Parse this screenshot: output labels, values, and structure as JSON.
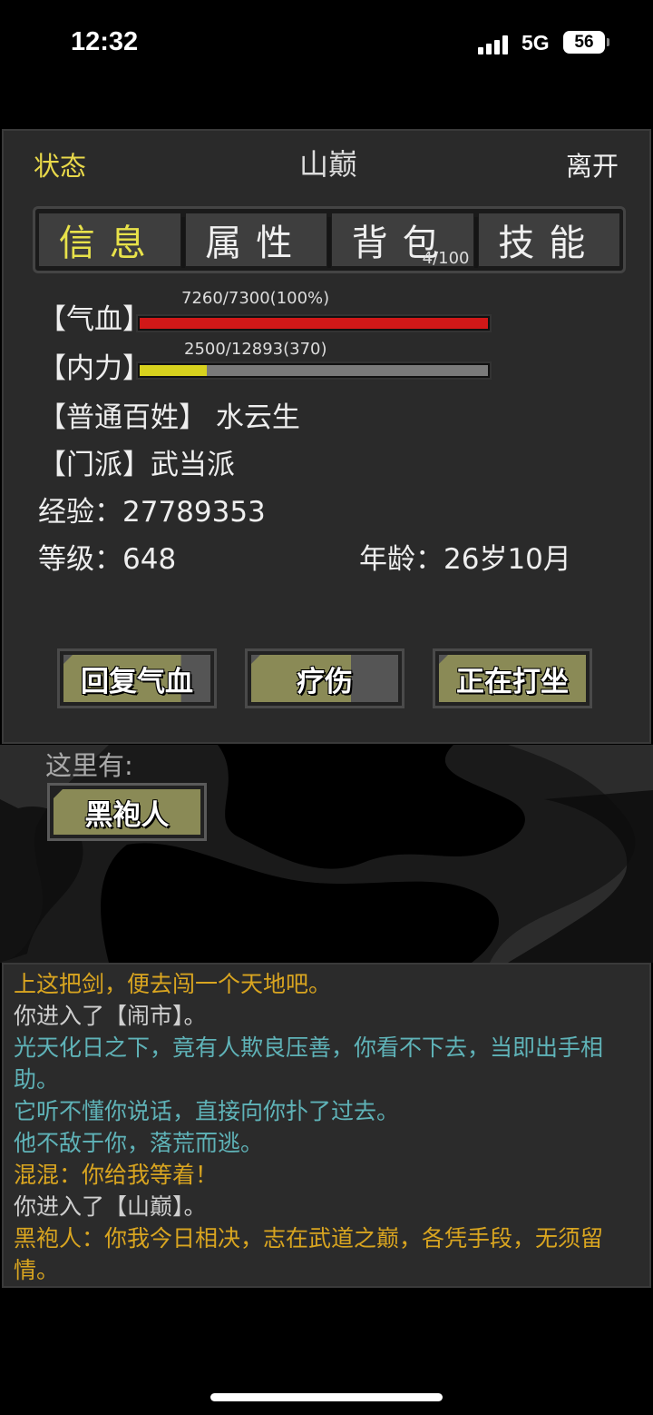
{
  "status_bar": {
    "time": "12:32",
    "network": "5G",
    "battery": "56"
  },
  "header": {
    "status_label": "状态",
    "title": "山巅",
    "leave_label": "离开"
  },
  "tabs": [
    {
      "label": "信息",
      "active": true
    },
    {
      "label": "属性",
      "active": false
    },
    {
      "label": "背包",
      "active": false,
      "badge": "4/100"
    },
    {
      "label": "技能",
      "active": false
    }
  ],
  "stats": {
    "hp": {
      "label": "【气血】",
      "value_text": "7260/7300(100%)",
      "fraction": 1.0,
      "color": "#d01818"
    },
    "mp": {
      "label": "【内力】",
      "value_text": "2500/12893(370)",
      "fraction": 0.194,
      "color": "#d8d21e"
    }
  },
  "profile": {
    "identity": "【普通百姓】 水云生",
    "sect": "【门派】武当派",
    "exp": "经验：27789353",
    "level": "等级：648",
    "age": "年龄：26岁10月"
  },
  "actions": [
    {
      "label": "回复气血",
      "fill": 0.8
    },
    {
      "label": "疗伤",
      "fill": 0.68
    },
    {
      "label": "正在打坐",
      "fill": 1.0
    }
  ],
  "scene": {
    "here_label": "这里有:",
    "npc": "黑袍人"
  },
  "log": [
    {
      "text": "上这把剑，便去闯一个天地吧。",
      "color": "#d9a520"
    },
    {
      "text": "你进入了【闹市】。",
      "color": "#cfcfcf"
    },
    {
      "text": "光天化日之下，竟有人欺良压善，你看不下去，当即出手相助。",
      "color": "#5fb3b8"
    },
    {
      "text": "它听不懂你说话，直接向你扑了过去。",
      "color": "#5fb3b8"
    },
    {
      "text": "他不敌于你，落荒而逃。",
      "color": "#5fb3b8"
    },
    {
      "text": "混混：你给我等着！",
      "color": "#d9a520"
    },
    {
      "text": "你进入了【山巅】。",
      "color": "#cfcfcf"
    },
    {
      "text": "黑袍人：你我今日相决，志在武道之巅，各凭手段，无须留情。",
      "color": "#d9a520"
    }
  ]
}
